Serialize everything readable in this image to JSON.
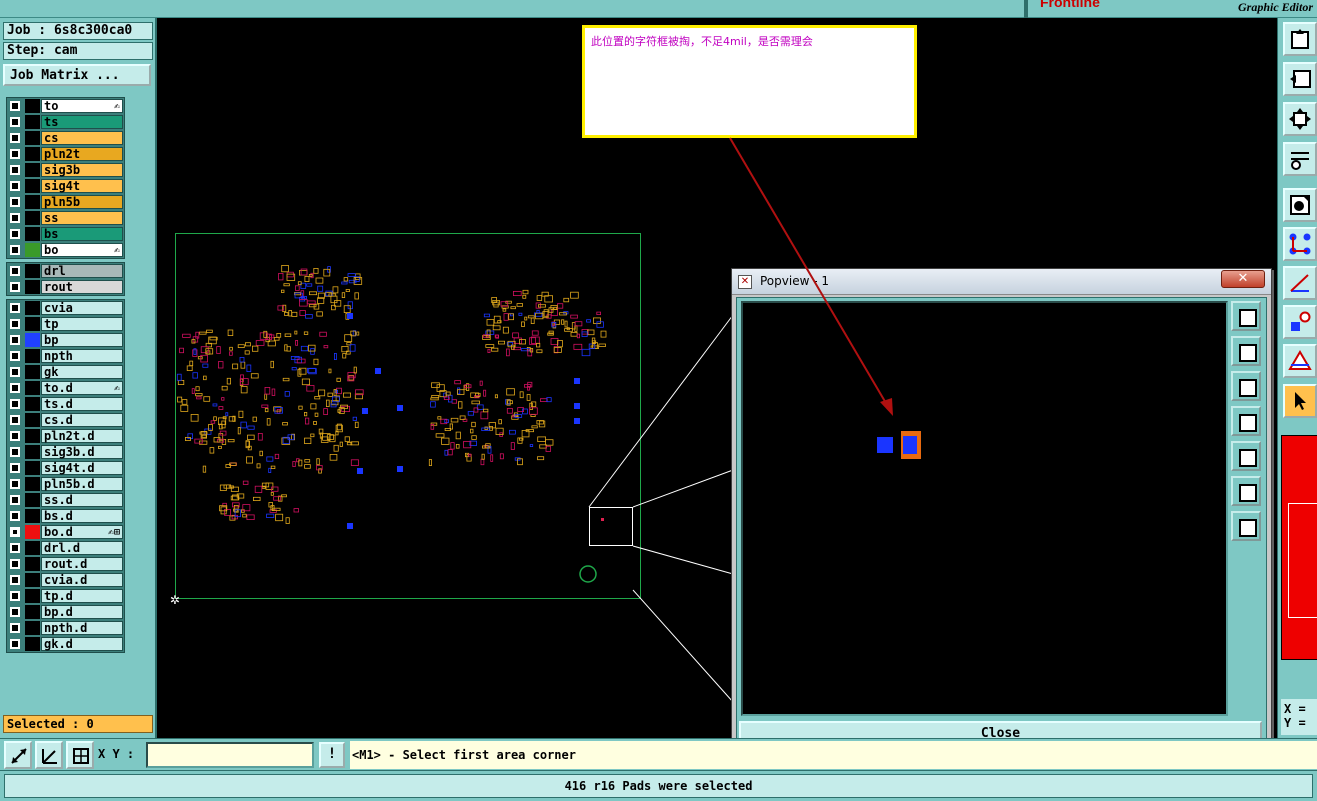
{
  "header": {
    "logo": "Frontline",
    "caption": "Graphic Editor"
  },
  "job": {
    "job_label": "Job : 6s8c300ca0",
    "step_label": "Step: cam",
    "matrix_button": "Job Matrix ..."
  },
  "layers": {
    "board": [
      {
        "name": "to",
        "color": "#ffffff",
        "swatch": "#000000",
        "mark": "✍"
      },
      {
        "name": "ts",
        "color": "#1a9a78",
        "swatch": "#000000",
        "mark": ""
      },
      {
        "name": "cs",
        "color": "#ffc04d",
        "swatch": "#000000",
        "mark": ""
      },
      {
        "name": "pln2t",
        "color": "#e8a820",
        "swatch": "#000000",
        "mark": ""
      },
      {
        "name": "sig3b",
        "color": "#ffc04d",
        "swatch": "#000000",
        "mark": ""
      },
      {
        "name": "sig4t",
        "color": "#ffc04d",
        "swatch": "#000000",
        "mark": ""
      },
      {
        "name": "pln5b",
        "color": "#e8a820",
        "swatch": "#000000",
        "mark": ""
      },
      {
        "name": "ss",
        "color": "#ffc04d",
        "swatch": "#000000",
        "mark": ""
      },
      {
        "name": "bs",
        "color": "#1a9a78",
        "swatch": "#000000",
        "mark": ""
      },
      {
        "name": "bo",
        "color": "#ffffff",
        "swatch": "#3a9a2a",
        "mark": "✍"
      }
    ],
    "drill": [
      {
        "name": "drl",
        "color": "#a8b8b8",
        "swatch": "#000000",
        "mark": ""
      },
      {
        "name": "rout",
        "color": "#d8d8d8",
        "swatch": "#000000",
        "mark": ""
      }
    ],
    "misc": [
      {
        "name": "cvia",
        "color": "#c5ecea",
        "swatch": "#000000",
        "mark": ""
      },
      {
        "name": "tp",
        "color": "#c5ecea",
        "swatch": "#000000",
        "mark": ""
      },
      {
        "name": "bp",
        "color": "#c5ecea",
        "swatch": "#2040ff",
        "mark": ""
      },
      {
        "name": "npth",
        "color": "#c5ecea",
        "swatch": "#000000",
        "mark": ""
      },
      {
        "name": "gk",
        "color": "#c5ecea",
        "swatch": "#000000",
        "mark": ""
      },
      {
        "name": "to.d",
        "color": "#c5ecea",
        "swatch": "#000000",
        "mark": "✍"
      },
      {
        "name": "ts.d",
        "color": "#c5ecea",
        "swatch": "#000000",
        "mark": ""
      },
      {
        "name": "cs.d",
        "color": "#c5ecea",
        "swatch": "#000000",
        "mark": ""
      },
      {
        "name": "pln2t.d",
        "color": "#c5ecea",
        "swatch": "#000000",
        "mark": ""
      },
      {
        "name": "sig3b.d",
        "color": "#c5ecea",
        "swatch": "#000000",
        "mark": ""
      },
      {
        "name": "sig4t.d",
        "color": "#c5ecea",
        "swatch": "#000000",
        "mark": ""
      },
      {
        "name": "pln5b.d",
        "color": "#c5ecea",
        "swatch": "#000000",
        "mark": ""
      },
      {
        "name": "ss.d",
        "color": "#c5ecea",
        "swatch": "#000000",
        "mark": ""
      },
      {
        "name": "bs.d",
        "color": "#c5ecea",
        "swatch": "#000000",
        "mark": ""
      },
      {
        "name": "bo.d",
        "color": "#c5ecea",
        "swatch": "#ee1010",
        "mark": "✍⊞",
        "checked": true
      },
      {
        "name": "drl.d",
        "color": "#c5ecea",
        "swatch": "#000000",
        "mark": ""
      },
      {
        "name": "rout.d",
        "color": "#c5ecea",
        "swatch": "#000000",
        "mark": ""
      },
      {
        "name": "cvia.d",
        "color": "#c5ecea",
        "swatch": "#000000",
        "mark": ""
      },
      {
        "name": "tp.d",
        "color": "#c5ecea",
        "swatch": "#000000",
        "mark": ""
      },
      {
        "name": "bp.d",
        "color": "#c5ecea",
        "swatch": "#000000",
        "mark": ""
      },
      {
        "name": "npth.d",
        "color": "#c5ecea",
        "swatch": "#000000",
        "mark": ""
      },
      {
        "name": "gk.d",
        "color": "#c5ecea",
        "swatch": "#000000",
        "mark": ""
      }
    ]
  },
  "selection": {
    "label": "Selected : 0"
  },
  "annotation": {
    "text": "此位置的字符框被掏，不足4mil，是否需理会"
  },
  "popview": {
    "title": "Popview - 1",
    "close_x": "✕",
    "close_button": "Close"
  },
  "right_toolbar": {
    "x_label": "X =",
    "y_label": "Y ="
  },
  "command": {
    "xy_label": "X Y :",
    "xy_value": "",
    "exclaim": "!",
    "prompt": "<M1> - Select first area corner"
  },
  "status": {
    "message": "416 r16 Pads were selected"
  },
  "colors": {
    "panel_teal": "#7ec8c4",
    "field_light": "#c5ecea",
    "selected_orange": "#ffc04d",
    "board_outline": "#1fa84a",
    "pad_blue": "#1a35ff",
    "annotation_arrow": "#b01010",
    "annotation_border": "#ffef00",
    "annotation_text": "#c000c0"
  }
}
